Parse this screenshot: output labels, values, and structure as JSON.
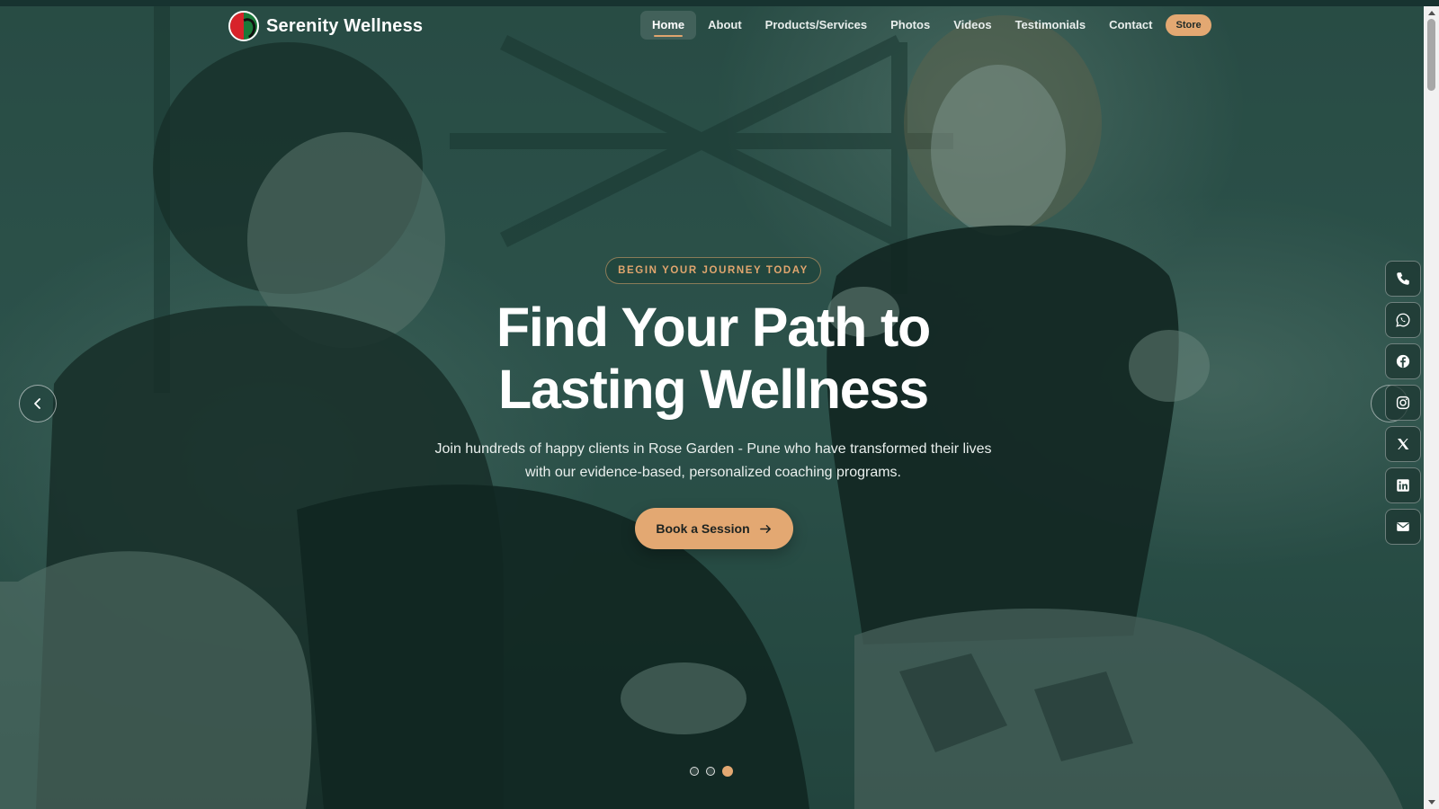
{
  "brand": {
    "name": "Serenity Wellness"
  },
  "nav": {
    "items": [
      {
        "label": "Home",
        "active": true
      },
      {
        "label": "About"
      },
      {
        "label": "Products/Services"
      },
      {
        "label": "Photos"
      },
      {
        "label": "Videos"
      },
      {
        "label": "Testimonials"
      },
      {
        "label": "Contact"
      }
    ],
    "store_label": "Store"
  },
  "hero": {
    "tagline": "BEGIN YOUR JOURNEY TODAY",
    "headline_line1": "Find Your Path to",
    "headline_line2": "Lasting Wellness",
    "subtext_line1": "Join hundreds of happy clients in Rose Garden - Pune who have transformed their lives",
    "subtext_line2": "with our evidence-based, personalized coaching programs.",
    "cta_label": "Book a Session"
  },
  "carousel": {
    "slide_count": 3,
    "active_slide": 3
  },
  "social": {
    "items": [
      {
        "icon": "phone-icon"
      },
      {
        "icon": "whatsapp-icon"
      },
      {
        "icon": "facebook-icon"
      },
      {
        "icon": "instagram-icon"
      },
      {
        "icon": "x-icon"
      },
      {
        "icon": "linkedin-icon"
      },
      {
        "icon": "email-icon"
      }
    ]
  },
  "colors": {
    "accent": "#e3a872",
    "overlay": "#123e34",
    "text": "#ffffff"
  }
}
